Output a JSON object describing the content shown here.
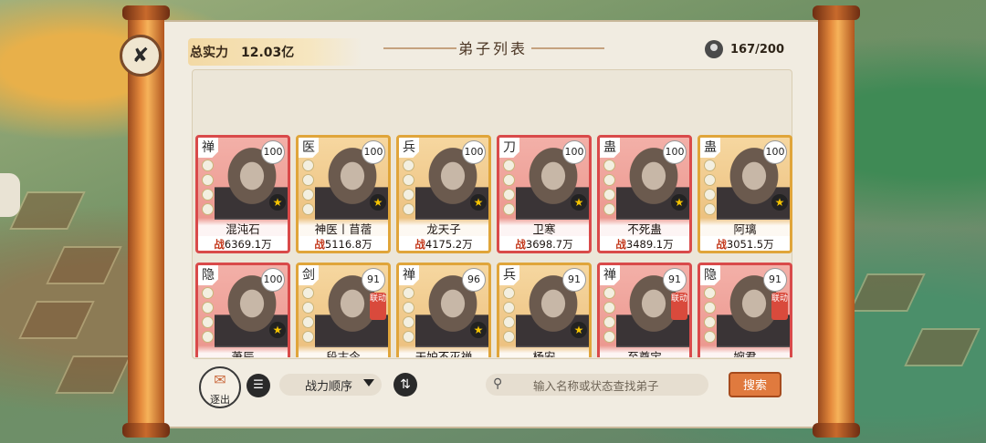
{
  "header": {
    "power_label": "总实力",
    "power_value": "12.03亿",
    "title": "弟子列表",
    "capacity": "167/200"
  },
  "disciples": [
    {
      "sect": "禅",
      "level": "100",
      "name": "混沌石",
      "power_prefix": "战",
      "power": "6369.1万",
      "frame": "red"
    },
    {
      "sect": "医",
      "level": "100",
      "name": "神医丨苜蓿",
      "power_prefix": "战",
      "power": "5116.8万",
      "frame": "gold"
    },
    {
      "sect": "兵",
      "level": "100",
      "name": "龙天子",
      "power_prefix": "战",
      "power": "4175.2万",
      "frame": "gold"
    },
    {
      "sect": "刀",
      "level": "100",
      "name": "卫寒",
      "power_prefix": "战",
      "power": "3698.7万",
      "frame": "red"
    },
    {
      "sect": "蛊",
      "level": "100",
      "name": "不死蛊",
      "power_prefix": "战",
      "power": "3489.1万",
      "frame": "red"
    },
    {
      "sect": "蛊",
      "level": "100",
      "name": "阿璃",
      "power_prefix": "战",
      "power": "3051.5万",
      "frame": "gold"
    },
    {
      "sect": "隐",
      "level": "100",
      "name": "萧辰",
      "power_prefix": "",
      "power": "",
      "frame": "red"
    },
    {
      "sect": "剑",
      "level": "91",
      "name": "段古今",
      "power_prefix": "",
      "power": "",
      "frame": "gold",
      "badge": "联动"
    },
    {
      "sect": "禅",
      "level": "96",
      "name": "天妒不灭禅",
      "power_prefix": "",
      "power": "",
      "frame": "gold"
    },
    {
      "sect": "兵",
      "level": "91",
      "name": "杨安",
      "power_prefix": "",
      "power": "",
      "frame": "gold"
    },
    {
      "sect": "禅",
      "level": "91",
      "name": "至尊宝",
      "power_prefix": "",
      "power": "",
      "frame": "red",
      "badge": "联动"
    },
    {
      "sect": "隐",
      "level": "91",
      "name": "婉君",
      "power_prefix": "",
      "power": "",
      "frame": "red",
      "badge": "联动"
    }
  ],
  "toolbar": {
    "exile_label": "逐出",
    "sort_label": "战力顺序",
    "search_placeholder": "输入名称或状态查找弟子",
    "search_button": "搜索"
  },
  "icons": [
    "sword-icon",
    "capacity-icon",
    "exile-icon",
    "list-icon",
    "dropdown-arrow-icon",
    "swap-icon",
    "search-icon",
    "star-icon"
  ]
}
